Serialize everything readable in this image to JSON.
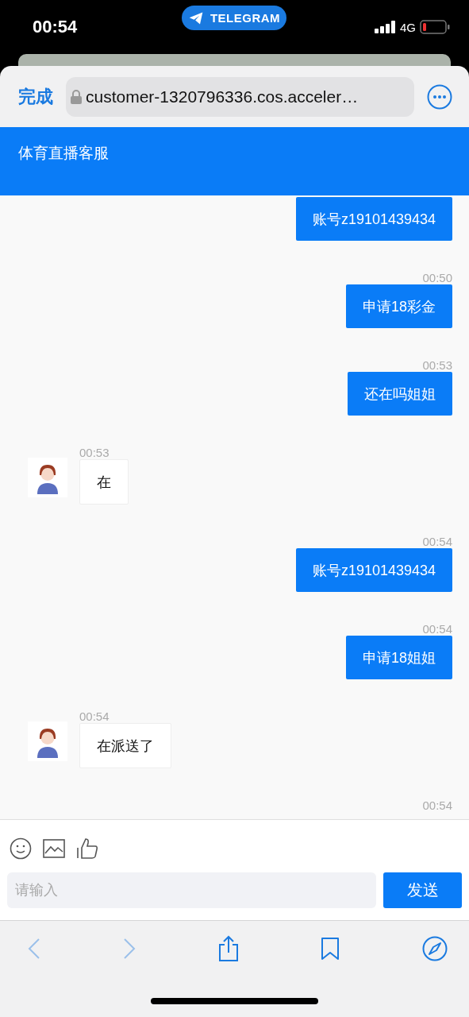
{
  "status_bar": {
    "time": "00:54",
    "app_pill": "TELEGRAM",
    "network": "4G"
  },
  "browser": {
    "done": "完成",
    "url": "customer-1320796336.cos.acceler…"
  },
  "header": {
    "title": "体育直播客服"
  },
  "messages": [
    {
      "kind": "sent",
      "text": "账号z19101439434"
    },
    {
      "kind": "sent",
      "time": "00:50",
      "text": "申请18彩金"
    },
    {
      "kind": "sent",
      "time": "00:53",
      "text": "还在吗姐姐"
    },
    {
      "kind": "received",
      "time": "00:53",
      "text": "在"
    },
    {
      "kind": "sent",
      "time": "00:54",
      "text": "账号z19101439434"
    },
    {
      "kind": "sent",
      "time": "00:54",
      "text": "申请18姐姐"
    },
    {
      "kind": "received",
      "time": "00:54",
      "text": "在派送了"
    },
    {
      "kind": "sent",
      "time": "00:54"
    }
  ],
  "composer": {
    "placeholder": "请输入",
    "send": "发送"
  }
}
